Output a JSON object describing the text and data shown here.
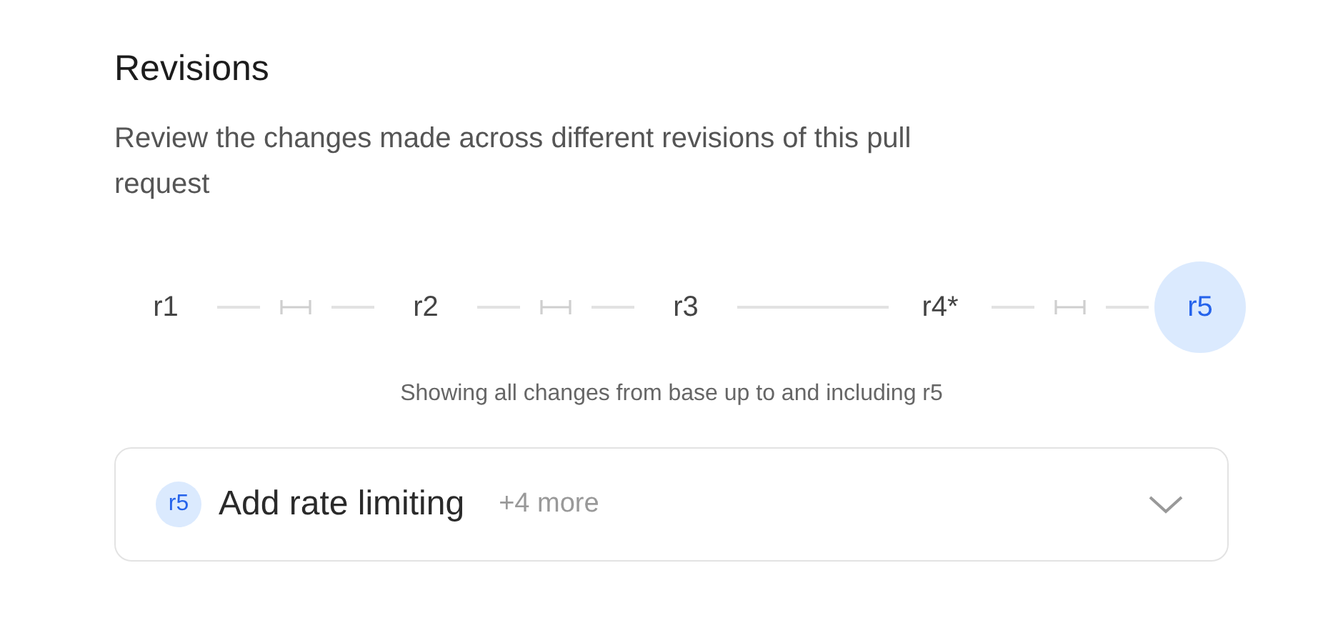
{
  "title": "Revisions",
  "description": "Review the changes made across different revisions of this pull request",
  "revisions": [
    {
      "label": "r1",
      "selected": false
    },
    {
      "label": "r2",
      "selected": false
    },
    {
      "label": "r3",
      "selected": false
    },
    {
      "label": "r4*",
      "selected": false
    },
    {
      "label": "r5",
      "selected": true
    }
  ],
  "connectors": [
    {
      "kind": "gap"
    },
    {
      "kind": "gap"
    },
    {
      "kind": "line"
    },
    {
      "kind": "gap"
    }
  ],
  "summary": "Showing all changes from base up to and including r5",
  "commit": {
    "badge": "r5",
    "title": "Add rate limiting",
    "more": "+4 more",
    "expanded": false
  }
}
